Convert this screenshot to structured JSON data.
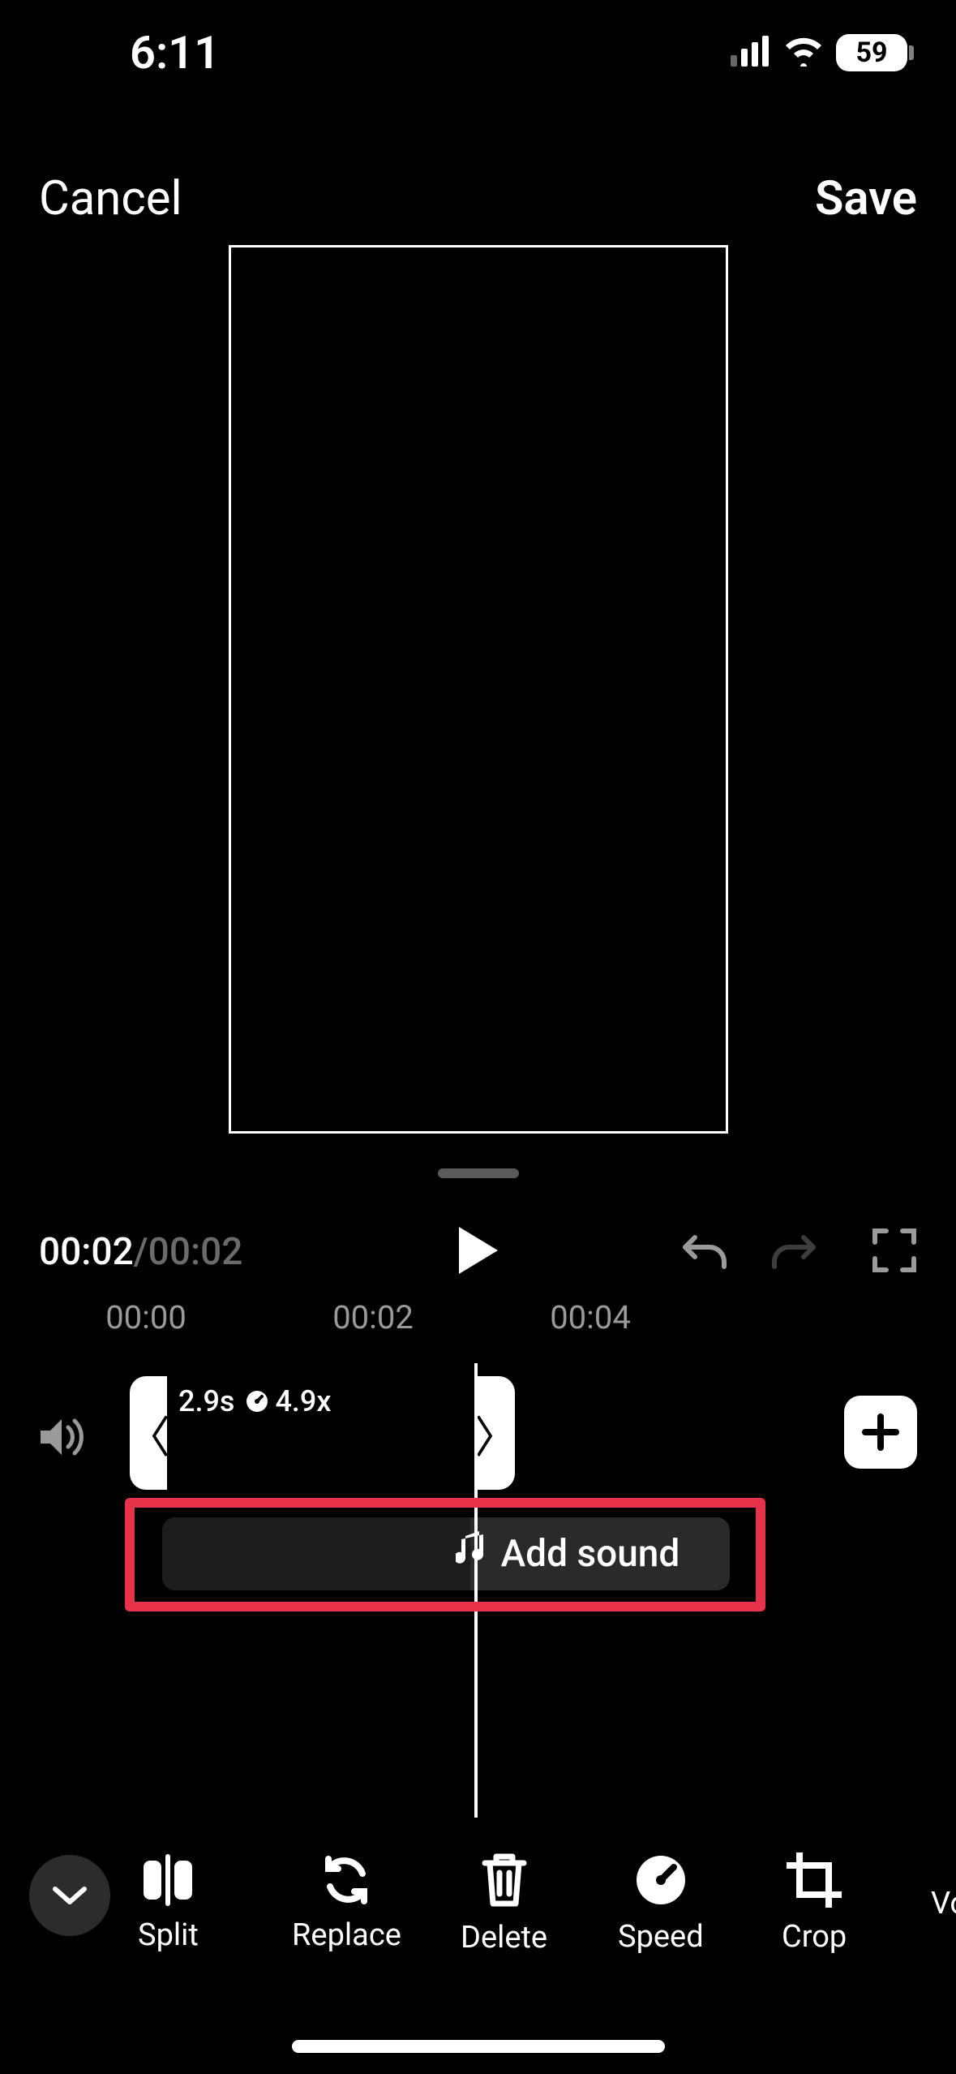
{
  "status": {
    "time": "6:11",
    "battery": "59"
  },
  "nav": {
    "cancel": "Cancel",
    "save": "Save"
  },
  "playback": {
    "current": "00:02",
    "total": "00:02"
  },
  "ruler": {
    "t0": "00:00",
    "t1": "00:02",
    "t2": "00:04"
  },
  "clip": {
    "duration": "2.9s",
    "speed": "4.9x"
  },
  "sound": {
    "label": "Add sound"
  },
  "tools": {
    "split": "Split",
    "replace": "Replace",
    "delete": "Delete",
    "speed": "Speed",
    "crop": "Crop",
    "volume": "Vo"
  }
}
